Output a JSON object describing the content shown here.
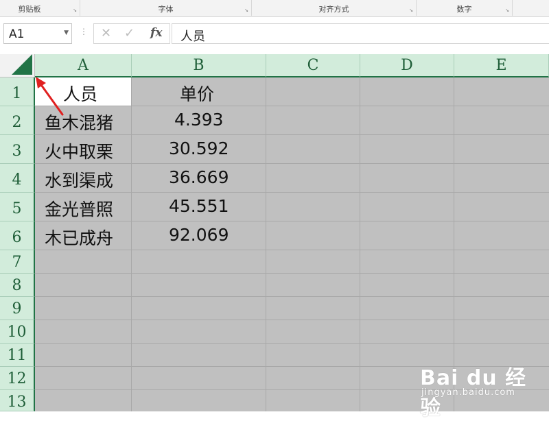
{
  "ribbon": {
    "groups": [
      {
        "label": "剪贴板"
      },
      {
        "label": "字体"
      },
      {
        "label": "对齐方式"
      },
      {
        "label": "数字"
      }
    ],
    "launcher_glyph": "↘"
  },
  "formula_bar": {
    "name_box": "A1",
    "cancel_glyph": "✕",
    "enter_glyph": "✓",
    "fx_label": "fx",
    "content": "人员"
  },
  "columns": [
    "A",
    "B",
    "C",
    "D",
    "E"
  ],
  "rows": [
    "1",
    "2",
    "3",
    "4",
    "5",
    "6",
    "7",
    "8",
    "9",
    "10",
    "11",
    "12",
    "13"
  ],
  "cells": {
    "A1": "人员",
    "B1": "单价",
    "A2": "鱼木混猪",
    "B2": "4.393",
    "A3": "火中取栗",
    "B3": "30.592",
    "A4": "水到渠成",
    "B4": "36.669",
    "A5": "金光普照",
    "B5": "45.551",
    "A6": "木已成舟",
    "B6": "92.069"
  },
  "watermark": {
    "brand": "Bai du 经验",
    "url": "jingyan.baidu.com"
  },
  "colors": {
    "accent_green": "#217346",
    "header_green": "#d2ecdb",
    "selection_gray": "#c0c0c0",
    "annotation_red": "#e02020"
  }
}
